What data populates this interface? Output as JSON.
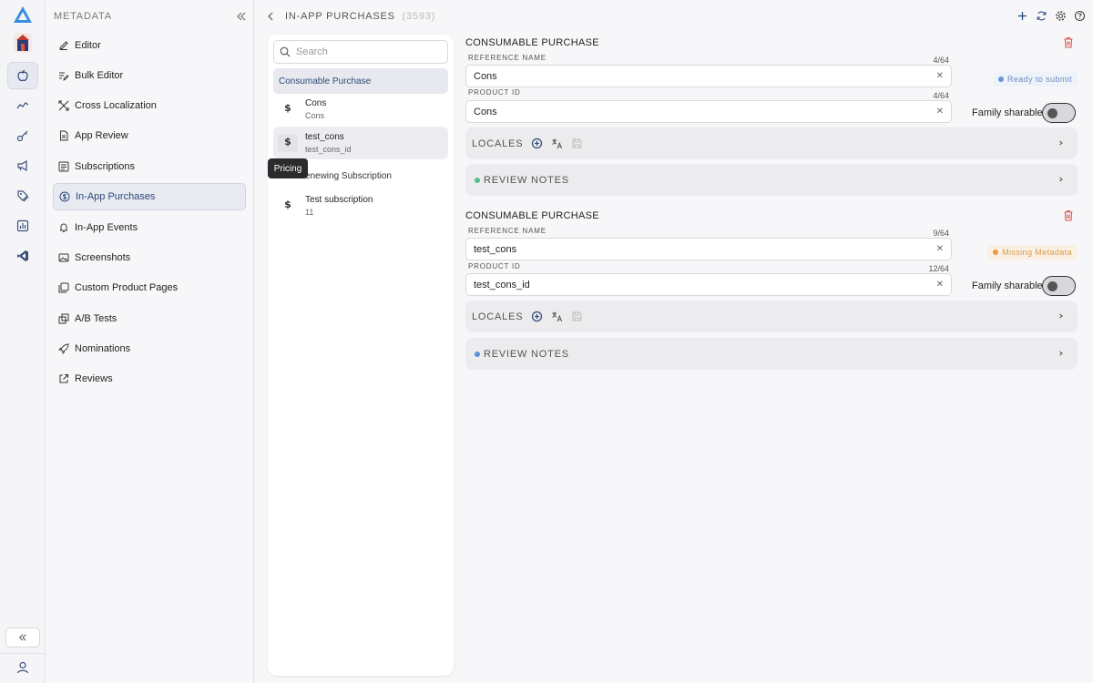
{
  "colors": {
    "accent": "#2e4a7a",
    "danger": "#d9534f",
    "ready": "#6a96d6",
    "missing": "#e89a45",
    "notes_green": "#4fc08d",
    "notes_blue": "#5b8fd8"
  },
  "rail": {
    "icons": [
      "app-logo-icon",
      "app-icon",
      "apple-icon",
      "analytics-icon",
      "key-icon",
      "megaphone-icon",
      "tags-icon",
      "reports-icon",
      "vscode-icon"
    ],
    "collapse_icon": "double-chevron-left-icon",
    "user_icon": "user-icon"
  },
  "metadata": {
    "title": "METADATA",
    "items": [
      {
        "label": "Editor",
        "icon": "pencil-icon"
      },
      {
        "label": "Bulk Editor",
        "icon": "bulk-edit-icon"
      },
      {
        "label": "Cross Localization",
        "icon": "cross-localization-icon"
      },
      {
        "label": "App Review",
        "icon": "document-icon"
      },
      {
        "label": "Subscriptions",
        "icon": "subscriptions-icon"
      },
      {
        "label": "In-App Purchases",
        "icon": "dollar-circle-icon"
      },
      {
        "label": "In-App Events",
        "icon": "calendar-icon"
      },
      {
        "label": "Screenshots",
        "icon": "screenshots-icon"
      },
      {
        "label": "Custom Product Pages",
        "icon": "pages-icon"
      },
      {
        "label": "A/B Tests",
        "icon": "ab-test-icon"
      },
      {
        "label": "Nominations",
        "icon": "rocket-icon"
      },
      {
        "label": "Reviews",
        "icon": "external-link-icon"
      }
    ],
    "active_index": 5
  },
  "header": {
    "title": "IN-APP PURCHASES",
    "count": "(3593)"
  },
  "list": {
    "search_placeholder": "Search",
    "groups": [
      {
        "label": "Consumable Purchase"
      },
      {
        "label": "Non-Renewing Subscription"
      }
    ],
    "rows": [
      {
        "name": "Cons",
        "sub": "Cons"
      },
      {
        "name": "test_cons",
        "sub": "test_cons_id"
      },
      {
        "name": "Test subscription",
        "sub": "11"
      }
    ],
    "tooltip": "Pricing"
  },
  "sections": [
    {
      "title": "CONSUMABLE PURCHASE",
      "reference_label": "REFERENCE NAME",
      "reference_value": "Cons",
      "reference_counter": "4/64",
      "product_label": "PRODUCT ID",
      "product_value": "Cons",
      "product_counter": "4/64",
      "status": "Ready to submit",
      "family_label": "Family sharable",
      "family_sharable": false,
      "locales_label": "LOCALES",
      "notes_label": "REVIEW NOTES"
    },
    {
      "title": "CONSUMABLE PURCHASE",
      "reference_label": "REFERENCE NAME",
      "reference_value": "test_cons",
      "reference_counter": "9/64",
      "product_label": "PRODUCT ID",
      "product_value": "test_cons_id",
      "product_counter": "12/64",
      "status": "Missing Metadata",
      "family_label": "Family sharable",
      "family_sharable": false,
      "locales_label": "LOCALES",
      "notes_label": "REVIEW NOTES"
    }
  ]
}
